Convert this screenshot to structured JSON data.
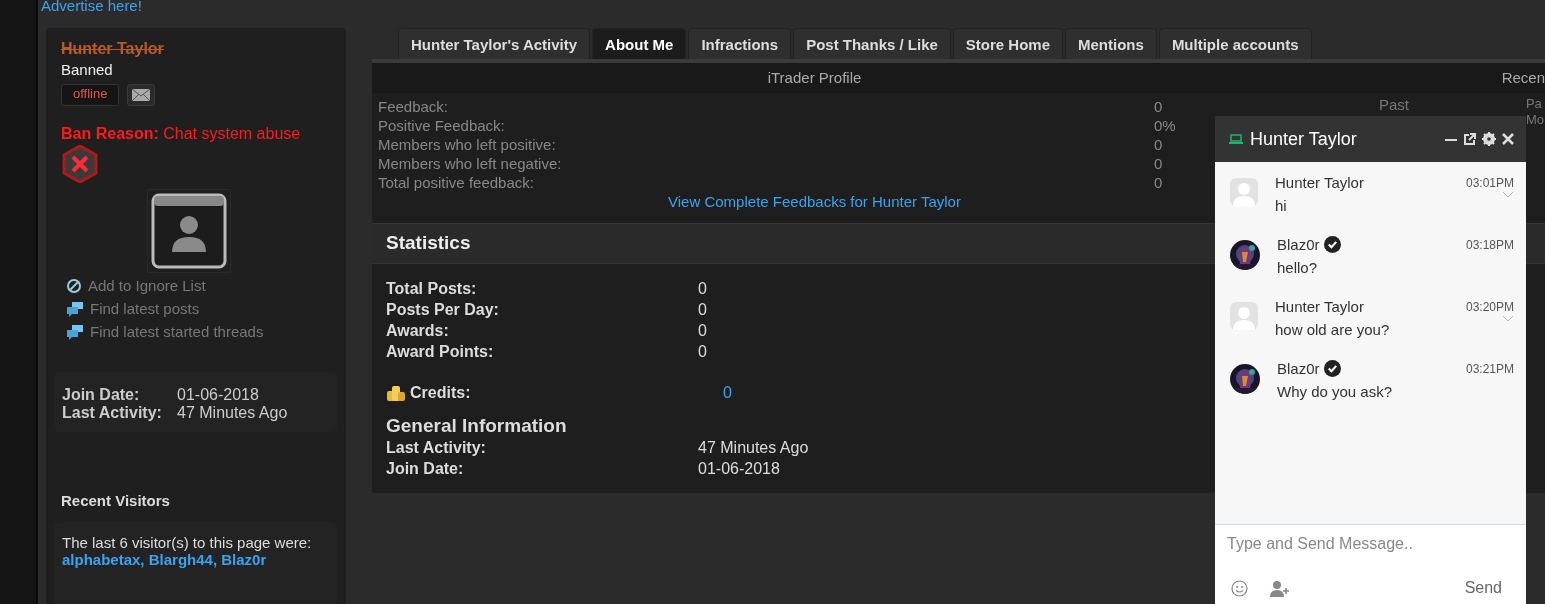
{
  "advertise_link": "Advertise here!",
  "profile": {
    "username": "Hunter Taylor",
    "struck_out": true,
    "usertitle": "Banned",
    "status": "offline",
    "ban_label": "Ban Reason:",
    "ban_reason": "Chat system abuse",
    "actions": [
      {
        "label": "Add to Ignore List",
        "kind": "ignore"
      },
      {
        "label": "Find latest posts",
        "kind": "find"
      },
      {
        "label": "Find latest started threads",
        "kind": "find"
      }
    ],
    "info": [
      {
        "label": "Join Date:",
        "value": "01-06-2018"
      },
      {
        "label": "Last Activity:",
        "value": "47 Minutes Ago"
      }
    ]
  },
  "recent_visitors": {
    "title": "Recent Visitors",
    "text": "The last 6 visitor(s) to this page were:",
    "names": "alphabetax, Blargh44, Blaz0r"
  },
  "tabs": [
    {
      "label": "Hunter Taylor's Activity",
      "selected": false
    },
    {
      "label": "About Me",
      "selected": true
    },
    {
      "label": "Infractions",
      "selected": false
    },
    {
      "label": "Post Thanks / Like",
      "selected": false
    },
    {
      "label": "Store Home",
      "selected": false
    },
    {
      "label": "Mentions",
      "selected": false
    },
    {
      "label": "Multiple accounts",
      "selected": false
    }
  ],
  "itrader": {
    "title": "iTrader Profile",
    "rows": [
      {
        "label": "Feedback:",
        "value": "0"
      },
      {
        "label": "Positive Feedback:",
        "value": "0%"
      },
      {
        "label": "Members who left positive:",
        "value": "0"
      },
      {
        "label": "Members who left negative:",
        "value": "0"
      },
      {
        "label": "Total positive feedback:",
        "value": "0"
      }
    ],
    "link": "View Complete Feedbacks for Hunter Taylor"
  },
  "recent_partial": {
    "heading": "Recen",
    "column_1": "Past",
    "column_2": "Pa",
    "column_2_sub": "Mo"
  },
  "statistics": {
    "title": "Statistics",
    "rows": [
      {
        "label": "Total Posts:",
        "value": "0"
      },
      {
        "label": "Posts Per Day:",
        "value": "0"
      },
      {
        "label": "Awards:",
        "value": "0"
      },
      {
        "label": "Award Points:",
        "value": "0"
      }
    ],
    "credits": {
      "label": "Credits:",
      "value": "0"
    },
    "general": {
      "title": "General Information",
      "rows": [
        {
          "label": "Last Activity:",
          "value": "47 Minutes Ago"
        },
        {
          "label": "Join Date:",
          "value": "01-06-2018"
        }
      ]
    }
  },
  "chat": {
    "title": "Hunter Taylor",
    "online": true,
    "messages": [
      {
        "sender": "Hunter Taylor",
        "verified": false,
        "kind": "placeholder",
        "time": "03:01PM",
        "text": "hi",
        "has_menu": true
      },
      {
        "sender": "Blaz0r",
        "verified": true,
        "time": "03:18PM",
        "text": "hello?",
        "has_menu": false
      },
      {
        "sender": "Hunter Taylor",
        "verified": false,
        "kind": "placeholder",
        "time": "03:20PM",
        "text": "how old are you?",
        "has_menu": true
      },
      {
        "sender": "Blaz0r",
        "verified": true,
        "time": "03:21PM",
        "text": "Why do you ask?",
        "has_menu": false
      }
    ],
    "placeholder": "Type and Send Message..",
    "send": "Send"
  }
}
